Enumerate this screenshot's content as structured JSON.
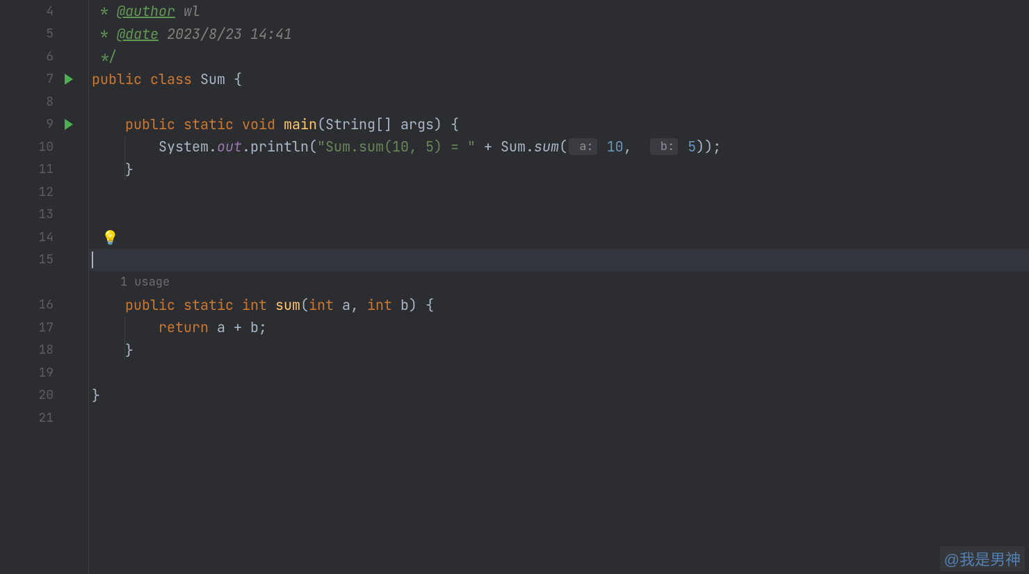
{
  "gutter": {
    "lines": [
      "4",
      "5",
      "6",
      "7",
      "8",
      "9",
      "10",
      "11",
      "12",
      "13",
      "14",
      "15",
      "",
      "16",
      "17",
      "18",
      "19",
      "20",
      "21"
    ],
    "runIcons": {
      "7": true,
      "9": true
    }
  },
  "code": {
    "line4": {
      "prefix": " * ",
      "tag": "@author",
      "rest": " wl"
    },
    "line5": {
      "prefix": " * ",
      "tag": "@date",
      "rest": " 2023/8/23 14:41"
    },
    "line6": {
      "text": " */"
    },
    "line7": {
      "kw1": "public",
      "kw2": "class",
      "name": "Sum",
      "brace": " {"
    },
    "line9": {
      "kw1": "public",
      "kw2": "static",
      "kw3": "void",
      "method": "main",
      "params_open": "(",
      "ptype": "String[]",
      "pname": " args",
      "params_close": ")",
      "brace": " {"
    },
    "line10": {
      "pre": "        System.",
      "out": "out",
      "mid": ".println(",
      "str": "\"Sum.sum(10, 5) = \"",
      "plus": " + Sum.",
      "call": "sum",
      "open": "(",
      "hint1": " a:",
      "arg1": " 10",
      "comma": ",  ",
      "hint2": " b:",
      "arg2": " 5",
      "close": "));"
    },
    "line11": {
      "text": "    }"
    },
    "usage": "1 usage",
    "line16": {
      "kw1": "public",
      "kw2": "static",
      "kw3": "int",
      "method": "sum",
      "open": "(",
      "t1": "int",
      "p1": " a",
      "c": ", ",
      "t2": "int",
      "p2": " b",
      "close": ")",
      "brace": " {"
    },
    "line17": {
      "kw": "return",
      "expr": " a + b;"
    },
    "line18": {
      "text": "    }"
    },
    "line20": {
      "text": "}"
    }
  },
  "watermark": "@我是男神",
  "bulb": "💡"
}
